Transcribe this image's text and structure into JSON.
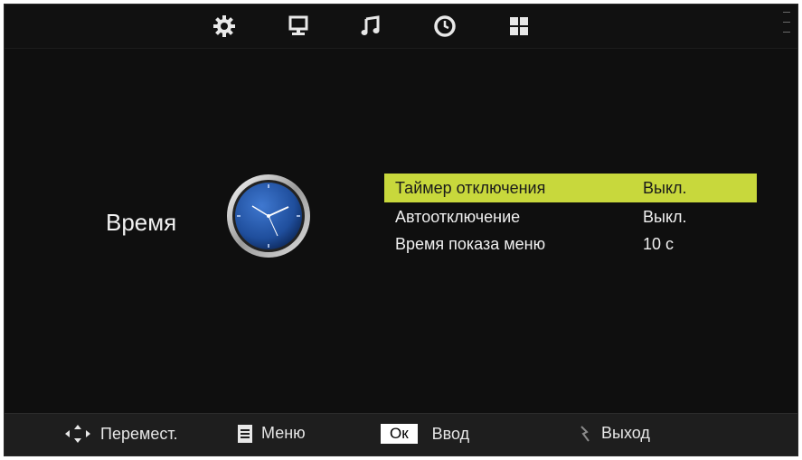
{
  "top_tabs": [
    {
      "name": "settings-gear-icon"
    },
    {
      "name": "display-icon"
    },
    {
      "name": "music-note-icon"
    },
    {
      "name": "clock-icon"
    },
    {
      "name": "grid-icon"
    }
  ],
  "section": {
    "title": "Время",
    "icon": "analog-clock-icon"
  },
  "menu": {
    "items": [
      {
        "label": "Таймер отключения",
        "value": "Выкл.",
        "selected": true
      },
      {
        "label": "Автоотключение",
        "value": "Выкл.",
        "selected": false
      },
      {
        "label": "Время показа меню",
        "value": "10 с",
        "selected": false
      }
    ]
  },
  "bottom_hints": {
    "move": {
      "icon": "dpad-arrows-icon",
      "label": "Перемест."
    },
    "menu": {
      "icon": "menu-list-icon",
      "label": "Меню"
    },
    "enter": {
      "key": "Ок",
      "label": "Ввод"
    },
    "exit": {
      "icon": "return-icon",
      "label": "Выход"
    }
  },
  "colors": {
    "background": "#0f0f0f",
    "highlight": "#c8d83c",
    "text": "#f0f0f0",
    "clock_face": "#1f4e9c"
  }
}
